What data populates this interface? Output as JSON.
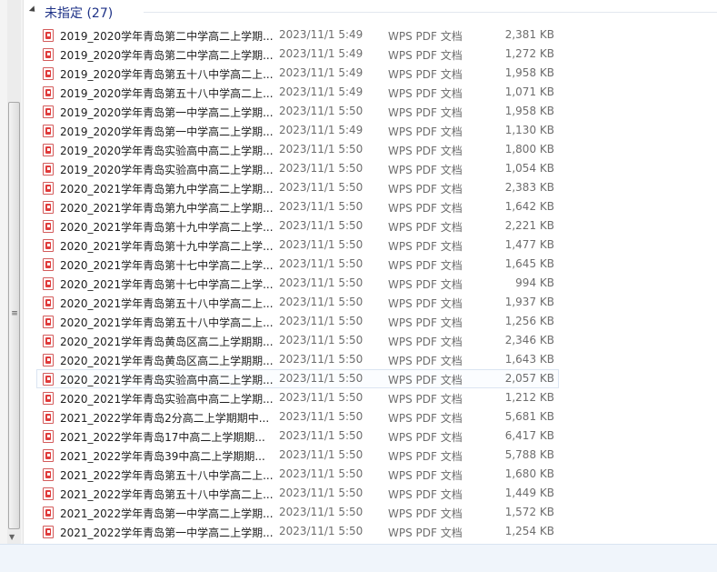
{
  "group": {
    "title": "未指定 (27)"
  },
  "scrollbar": {
    "grip": "≡",
    "down_arrow": "▼"
  },
  "files": [
    {
      "name": "2019_2020学年青岛第二中学高二上学期...",
      "date": "2023/11/1 5:49",
      "type": "WPS PDF 文档",
      "size": "2,381 KB"
    },
    {
      "name": "2019_2020学年青岛第二中学高二上学期...",
      "date": "2023/11/1 5:49",
      "type": "WPS PDF 文档",
      "size": "1,272 KB"
    },
    {
      "name": "2019_2020学年青岛第五十八中学高二上...",
      "date": "2023/11/1 5:49",
      "type": "WPS PDF 文档",
      "size": "1,958 KB"
    },
    {
      "name": "2019_2020学年青岛第五十八中学高二上...",
      "date": "2023/11/1 5:49",
      "type": "WPS PDF 文档",
      "size": "1,071 KB"
    },
    {
      "name": "2019_2020学年青岛第一中学高二上学期...",
      "date": "2023/11/1 5:50",
      "type": "WPS PDF 文档",
      "size": "1,958 KB"
    },
    {
      "name": "2019_2020学年青岛第一中学高二上学期...",
      "date": "2023/11/1 5:49",
      "type": "WPS PDF 文档",
      "size": "1,130 KB"
    },
    {
      "name": "2019_2020学年青岛实验高中高二上学期...",
      "date": "2023/11/1 5:50",
      "type": "WPS PDF 文档",
      "size": "1,800 KB"
    },
    {
      "name": "2019_2020学年青岛实验高中高二上学期...",
      "date": "2023/11/1 5:50",
      "type": "WPS PDF 文档",
      "size": "1,054 KB"
    },
    {
      "name": "2020_2021学年青岛第九中学高二上学期...",
      "date": "2023/11/1 5:50",
      "type": "WPS PDF 文档",
      "size": "2,383 KB"
    },
    {
      "name": "2020_2021学年青岛第九中学高二上学期...",
      "date": "2023/11/1 5:50",
      "type": "WPS PDF 文档",
      "size": "1,642 KB"
    },
    {
      "name": "2020_2021学年青岛第十九中学高二上学...",
      "date": "2023/11/1 5:50",
      "type": "WPS PDF 文档",
      "size": "2,221 KB"
    },
    {
      "name": "2020_2021学年青岛第十九中学高二上学...",
      "date": "2023/11/1 5:50",
      "type": "WPS PDF 文档",
      "size": "1,477 KB"
    },
    {
      "name": "2020_2021学年青岛第十七中学高二上学...",
      "date": "2023/11/1 5:50",
      "type": "WPS PDF 文档",
      "size": "1,645 KB"
    },
    {
      "name": "2020_2021学年青岛第十七中学高二上学...",
      "date": "2023/11/1 5:50",
      "type": "WPS PDF 文档",
      "size": "994 KB"
    },
    {
      "name": "2020_2021学年青岛第五十八中学高二上...",
      "date": "2023/11/1 5:50",
      "type": "WPS PDF 文档",
      "size": "1,937 KB"
    },
    {
      "name": "2020_2021学年青岛第五十八中学高二上...",
      "date": "2023/11/1 5:50",
      "type": "WPS PDF 文档",
      "size": "1,256 KB"
    },
    {
      "name": "2020_2021学年青岛黄岛区高二上学期期...",
      "date": "2023/11/1 5:50",
      "type": "WPS PDF 文档",
      "size": "2,346 KB"
    },
    {
      "name": "2020_2021学年青岛黄岛区高二上学期期...",
      "date": "2023/11/1 5:50",
      "type": "WPS PDF 文档",
      "size": "1,643 KB"
    },
    {
      "name": "2020_2021学年青岛实验高中高二上学期...",
      "date": "2023/11/1 5:50",
      "type": "WPS PDF 文档",
      "size": "2,057 KB",
      "hover": true
    },
    {
      "name": "2020_2021学年青岛实验高中高二上学期...",
      "date": "2023/11/1 5:50",
      "type": "WPS PDF 文档",
      "size": "1,212 KB"
    },
    {
      "name": "2021_2022学年青岛2分高二上学期期中...",
      "date": "2023/11/1 5:50",
      "type": "WPS PDF 文档",
      "size": "5,681 KB"
    },
    {
      "name": "2021_2022学年青岛17中高二上学期期...",
      "date": "2023/11/1 5:50",
      "type": "WPS PDF 文档",
      "size": "6,417 KB"
    },
    {
      "name": "2021_2022学年青岛39中高二上学期期...",
      "date": "2023/11/1 5:50",
      "type": "WPS PDF 文档",
      "size": "5,788 KB"
    },
    {
      "name": "2021_2022学年青岛第五十八中学高二上...",
      "date": "2023/11/1 5:50",
      "type": "WPS PDF 文档",
      "size": "1,680 KB"
    },
    {
      "name": "2021_2022学年青岛第五十八中学高二上...",
      "date": "2023/11/1 5:50",
      "type": "WPS PDF 文档",
      "size": "1,449 KB"
    },
    {
      "name": "2021_2022学年青岛第一中学高二上学期...",
      "date": "2023/11/1 5:50",
      "type": "WPS PDF 文档",
      "size": "1,572 KB"
    },
    {
      "name": "2021_2022学年青岛第一中学高二上学期...",
      "date": "2023/11/1 5:50",
      "type": "WPS PDF 文档",
      "size": "1,254 KB"
    }
  ]
}
